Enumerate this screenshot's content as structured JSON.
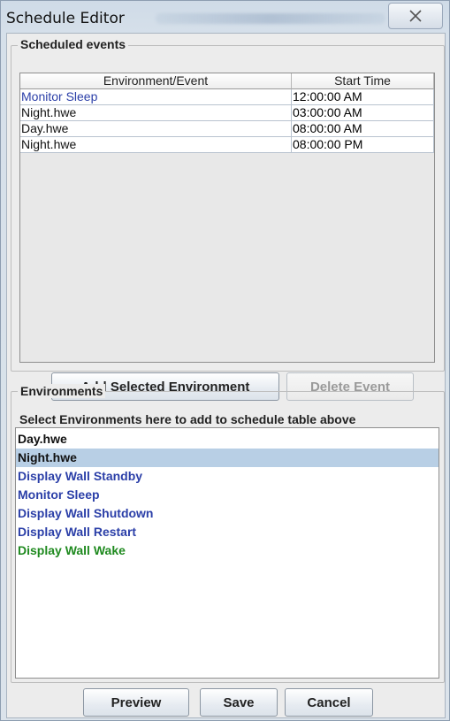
{
  "window": {
    "title": "Schedule Editor"
  },
  "scheduled_events": {
    "legend": "Scheduled events",
    "columns": [
      "Environment/Event",
      "Start Time"
    ],
    "rows": [
      {
        "event": "Monitor Sleep",
        "start": "12:00:00 AM",
        "color": "#2b3fa8"
      },
      {
        "event": "Night.hwe",
        "start": "03:00:00 AM",
        "color": "#111111"
      },
      {
        "event": "Day.hwe",
        "start": "08:00:00 AM",
        "color": "#111111"
      },
      {
        "event": "Night.hwe",
        "start": "08:00:00 PM",
        "color": "#111111"
      }
    ],
    "add_button": "Add Selected Environment",
    "delete_button": "Delete Event"
  },
  "environments": {
    "legend": "Environments",
    "caption": "Select Environments here to add to schedule table above",
    "items": [
      {
        "label": "Day.hwe",
        "color": "#111111",
        "selected": false
      },
      {
        "label": "Night.hwe",
        "color": "#111111",
        "selected": true
      },
      {
        "label": "Display Wall Standby",
        "color": "#2b3fa8",
        "selected": false
      },
      {
        "label": "Monitor Sleep",
        "color": "#2b3fa8",
        "selected": false
      },
      {
        "label": "Display Wall Shutdown",
        "color": "#2b3fa8",
        "selected": false
      },
      {
        "label": "Display Wall Restart",
        "color": "#2b3fa8",
        "selected": false
      },
      {
        "label": "Display Wall Wake",
        "color": "#1f8a1f",
        "selected": false
      }
    ],
    "selection_color": "#b8cfe5"
  },
  "footer": {
    "preview_button": "Preview",
    "save_button": "Save",
    "cancel_button": "Cancel"
  },
  "icons": {
    "close": "close-icon"
  }
}
